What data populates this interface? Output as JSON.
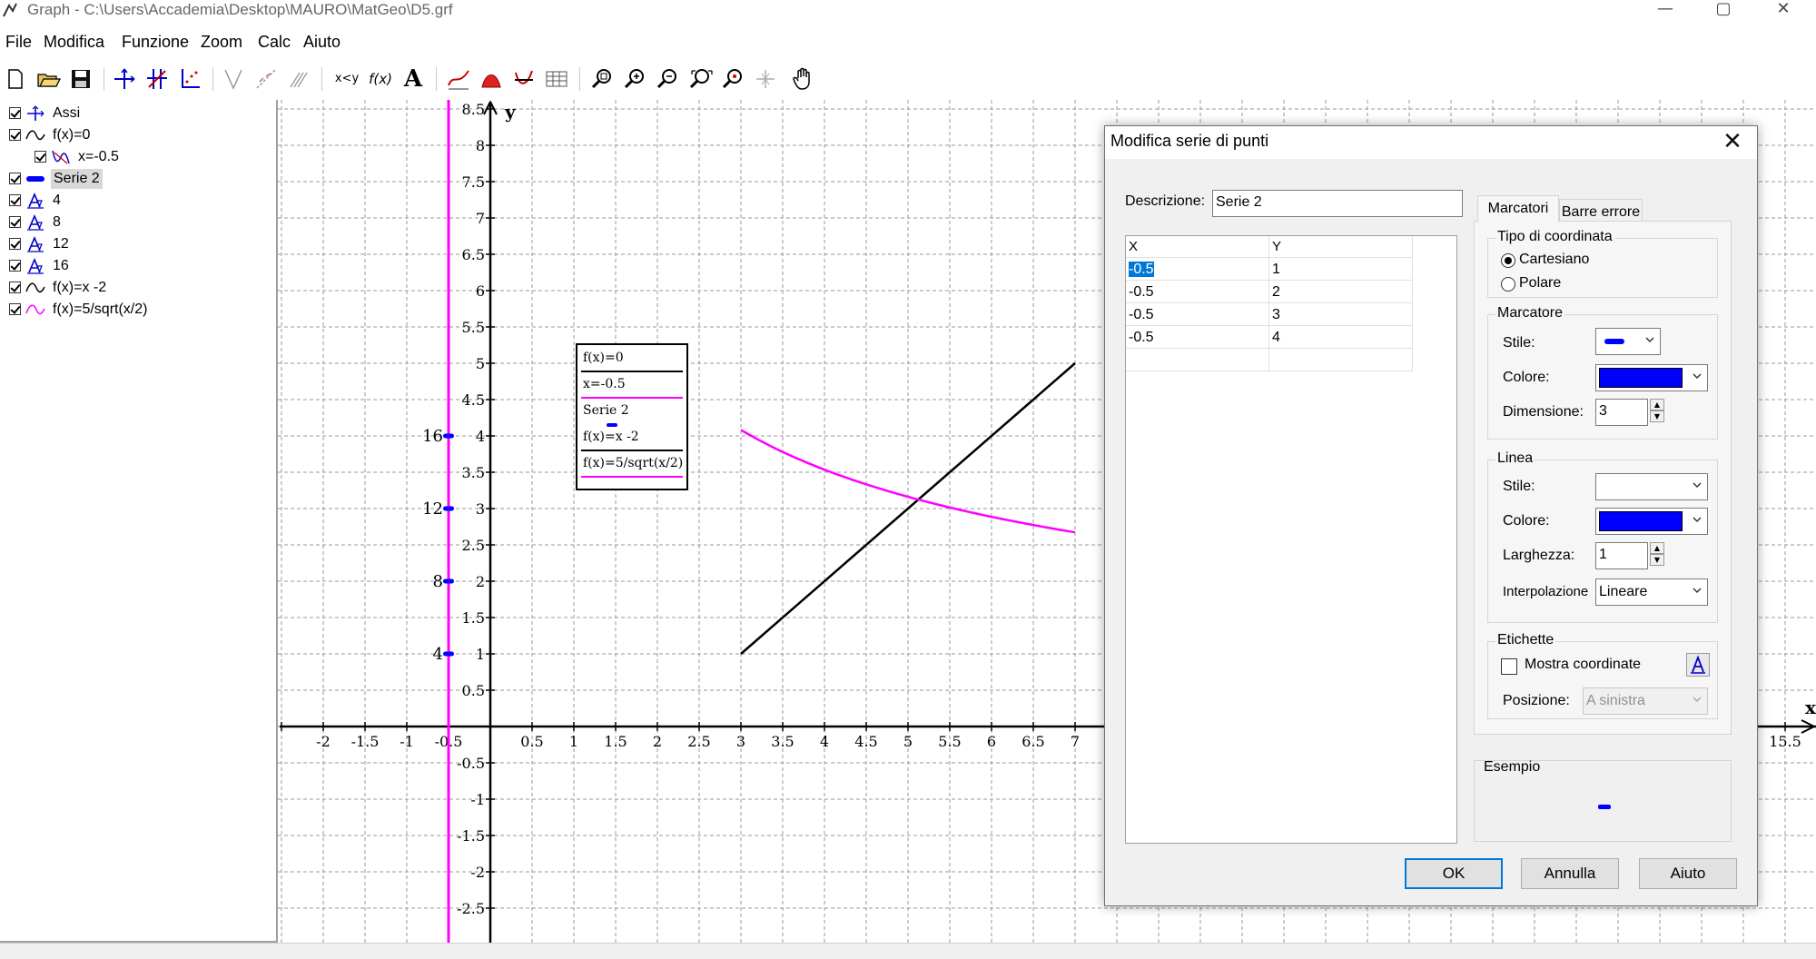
{
  "window": {
    "title": "Graph - C:\\Users\\Accademia\\Desktop\\MAURO\\MatGeo\\D5.grf",
    "minimize": "—",
    "maximize": "▢",
    "close": "✕"
  },
  "menu": [
    "File",
    "Modifica",
    "Funzione",
    "Zoom",
    "Calc",
    "Aiuto"
  ],
  "toolbar": {
    "icons": [
      "new-file-icon",
      "open-folder-icon",
      "save-icon",
      "axes-icon",
      "insert-grid-icon",
      "insert-axes-icon",
      "tangent-icon",
      "trendline-icon",
      "shading-hatch-icon",
      "xy-icon",
      "f-of-x-icon",
      "text-label-icon",
      "insert-function-icon",
      "shading-icon",
      "point-series-icon",
      "table-icon",
      "zoom-window-icon",
      "zoom-in-icon",
      "zoom-out-icon",
      "zoom-fit-icon",
      "zoom-standard-icon",
      "move-axes-icon",
      "pan-hand-icon"
    ],
    "xy_label": "x<y",
    "fx_label": "f(x)",
    "text_label": "A"
  },
  "tree": [
    {
      "label": "Assi",
      "icon": "axes-icon",
      "checked": true,
      "indent": 0,
      "selected": false
    },
    {
      "label": "f(x)=0",
      "icon": "function-curve-icon",
      "checked": true,
      "indent": 0,
      "selected": false
    },
    {
      "label": "x=-0.5",
      "icon": "relation-curve-icon",
      "checked": true,
      "indent": 1,
      "selected": false
    },
    {
      "label": "Serie 2",
      "icon": "point-series-icon",
      "checked": true,
      "indent": 0,
      "selected": true
    },
    {
      "label": "4",
      "icon": "text-label-icon",
      "checked": true,
      "indent": 0,
      "selected": false
    },
    {
      "label": "8",
      "icon": "text-label-icon",
      "checked": true,
      "indent": 0,
      "selected": false
    },
    {
      "label": "12",
      "icon": "text-label-icon",
      "checked": true,
      "indent": 0,
      "selected": false
    },
    {
      "label": "16",
      "icon": "text-label-icon",
      "checked": true,
      "indent": 0,
      "selected": false
    },
    {
      "label": "f(x)=x -2",
      "icon": "function-curve-icon",
      "checked": true,
      "indent": 0,
      "selected": false
    },
    {
      "label": "f(x)=5/sqrt(x/2)",
      "icon": "function-curve-pink-icon",
      "checked": true,
      "indent": 0,
      "selected": false
    }
  ],
  "plot": {
    "x_axis_label": "x",
    "y_axis_label": "y",
    "x_ticks": [
      "-2",
      "-1.5",
      "-1",
      "-0.5",
      "0.5",
      "1",
      "1.5",
      "2",
      "2.5",
      "3",
      "3.5",
      "4",
      "4.5",
      "5",
      "5.5",
      "6",
      "6.5",
      "7",
      "15.5"
    ],
    "y_ticks": [
      "8.5",
      "8",
      "7.5",
      "7",
      "6.5",
      "6",
      "5.5",
      "5",
      "4.5",
      "4",
      "3.5",
      "3",
      "2.5",
      "2",
      "1.5",
      "1",
      "0.5",
      "-0.5",
      "-1",
      "-1.5",
      "-2",
      "-2.5"
    ],
    "point_labels": [
      {
        "text": "16",
        "y": 4
      },
      {
        "text": "12",
        "y": 3
      },
      {
        "text": "8",
        "y": 2
      },
      {
        "text": "4",
        "y": 1
      }
    ],
    "legend": [
      {
        "label": "f(x)=0",
        "color": "#000000",
        "kind": "line"
      },
      {
        "label": "x=-0.5",
        "color": "#ff00ff",
        "kind": "line"
      },
      {
        "label": "Serie 2",
        "color": "#0000ff",
        "kind": "marker"
      },
      {
        "label": "f(x)=x -2",
        "color": "#000000",
        "kind": "line"
      },
      {
        "label": "f(x)=5/sqrt(x/2)",
        "color": "#ff00ff",
        "kind": "line"
      }
    ],
    "series": {
      "vertical_line_x": -0.5,
      "vertical_line_color": "#ff00ff",
      "points": [
        {
          "x": -0.5,
          "y": 1
        },
        {
          "x": -0.5,
          "y": 2
        },
        {
          "x": -0.5,
          "y": 3
        },
        {
          "x": -0.5,
          "y": 4
        }
      ],
      "linear": {
        "expr": "x-2",
        "from": 3,
        "to": 7,
        "color": "#000000"
      },
      "sqrt": {
        "expr": "5/sqrt(x/2)",
        "from": 3,
        "to": 7,
        "color": "#ff00ff"
      }
    }
  },
  "dialog": {
    "title": "Modifica serie di punti",
    "close": "✕",
    "description_label": "Descrizione:",
    "description_value": "Serie 2",
    "table": {
      "headers": [
        "X",
        "Y"
      ],
      "rows": [
        [
          "-0.5",
          "1"
        ],
        [
          "-0.5",
          "2"
        ],
        [
          "-0.5",
          "3"
        ],
        [
          "-0.5",
          "4"
        ],
        [
          "",
          ""
        ]
      ]
    },
    "tabs": [
      "Marcatori",
      "Barre errore"
    ],
    "coord_group": {
      "title": "Tipo di coordinata",
      "options": [
        "Cartesiano",
        "Polare"
      ],
      "selected": "Cartesiano"
    },
    "marker_group": {
      "title": "Marcatore",
      "style_label": "Stile:",
      "color_label": "Colore:",
      "size_label": "Dimensione:",
      "size_value": "3",
      "color": "#0000ff"
    },
    "line_group": {
      "title": "Linea",
      "style_label": "Stile:",
      "color_label": "Colore:",
      "width_label": "Larghezza:",
      "width_value": "1",
      "interp_label": "Interpolazione",
      "interp_value": "Lineare",
      "color": "#0000ff"
    },
    "labels_group": {
      "title": "Etichette",
      "show_coords_label": "Mostra coordinate",
      "show_coords_checked": false,
      "position_label": "Posizione:",
      "position_value": "A sinistra"
    },
    "example_label": "Esempio",
    "buttons": {
      "ok": "OK",
      "cancel": "Annulla",
      "help": "Aiuto"
    }
  }
}
